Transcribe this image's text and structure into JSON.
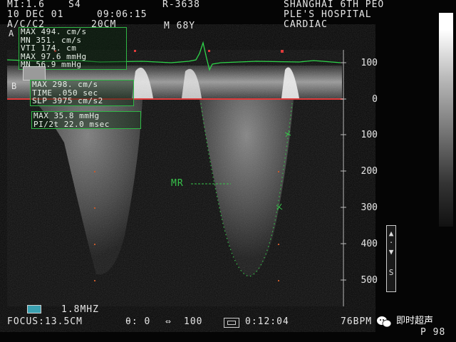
{
  "header": {
    "mi": "MI:1.6",
    "probe": "S4",
    "date": "10 DEC  01",
    "time": "09:06:15",
    "patient_id": "R-3638",
    "line3_left": "A/C/C2",
    "line3_depth": "20CM",
    "sex_age": "M  68Y",
    "hospital_line1": "SHANGHAI 6TH PEO",
    "hospital_line2": "PLE'S HOSPITAL",
    "hospital_line3": "CARDIAC",
    "mode_tag": "A"
  },
  "measurements": {
    "box1": [
      "MAX 494. cm/s",
      "MN  351. cm/s",
      "VTI 174. cm",
      "MAX 97.6 mmHg",
      "MN  56.9 mmHg"
    ],
    "box2": [
      "MAX  298. cm/s",
      "TIME .050 sec",
      "SLP  3975 cm/s2"
    ],
    "box2_tag": "B",
    "box3": [
      "MAX  35.8 mmHg",
      "PI/2t 22.0 msec"
    ]
  },
  "scale": {
    "labels": [
      "100",
      "0",
      "100",
      "200",
      "300",
      "400",
      "500"
    ],
    "unit": "cm/s"
  },
  "annotation": {
    "label": "MR"
  },
  "side_control": {
    "label": "S",
    "arrows": "↑↓"
  },
  "footer": {
    "frequency": "1.8MHZ",
    "focus": "FOCUS:13.5CM",
    "angle": "θ: 0",
    "scale_value": "100",
    "scale_icon": "⇔",
    "timer": "0:12:04",
    "heart_rate": "76BPM",
    "page": "P 98",
    "watermark": "即时超声"
  },
  "colors": {
    "ecg": "#2fd44a",
    "baseline": "#e03a3a",
    "overlay": "#37c24a"
  }
}
